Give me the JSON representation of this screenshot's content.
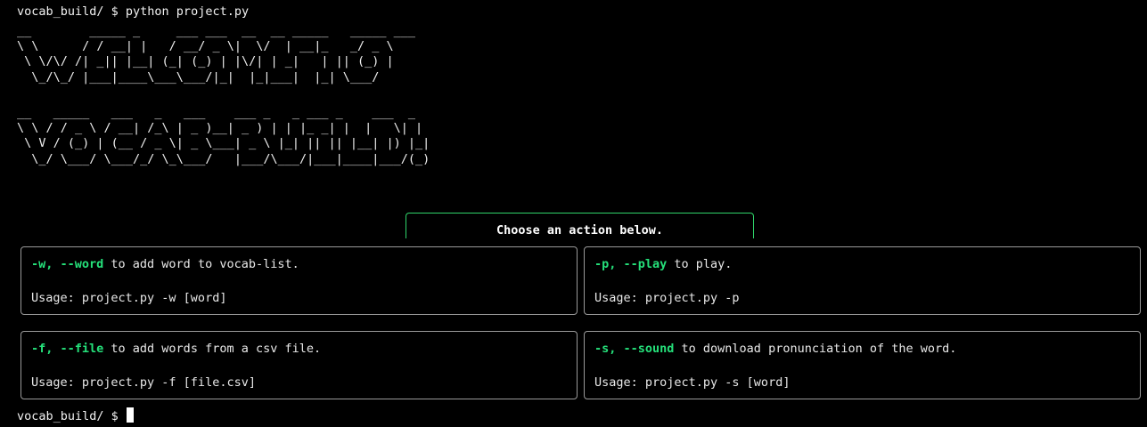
{
  "terminal": {
    "command_line": "vocab_build/ $ python project.py",
    "banner_top": "__        _____ _     ___ ___  __  __ _____   _____ ___\n\\ \\      / / __| |   / __/ _ \\|  \\/  | __|_   _/ _ \\\n \\ \\/\\/ /| _|| |__| (_| (_) | |\\/| | _|   | || (_) |\n  \\_/\\_/ |___|____\\___\\___/|_|  |_|___|  |_| \\___/",
    "banner_bottom": "__   _____   ___   _   ___    ___ _   _ ___ _    ___  _\n\\ \\ / / _ \\ / __| /_\\ | _ )__| _ ) | | |_ _| |  |   \\| |\n \\ V / (_) | (__ / _ \\| _ \\___| _ \\ |_| || || |__| |) |_|\n  \\_/ \\___/ \\___/_/ \\_\\___/   |___/\\___/|___|____|___/(_)",
    "panel_title": "Choose an action below.",
    "final_prompt": "vocab_build/ $ "
  },
  "actions": [
    {
      "flags": "-w, --word",
      "description": " to add word to vocab-list.",
      "usage": "Usage: project.py -w [word]"
    },
    {
      "flags": "-p, --play",
      "description": " to play.",
      "usage": "Usage: project.py -p"
    },
    {
      "flags": "-f, --file",
      "description": " to add words from a csv file.",
      "usage": "Usage: project.py -f [file.csv]"
    },
    {
      "flags": "-s, --sound",
      "description": " to download pronunciation of the word.",
      "usage": "Usage: project.py -s [word]"
    }
  ],
  "colors": {
    "background": "#000000",
    "flag_green": "#25e07a",
    "title_border": "#2fd46a",
    "card_border": "#9a9a9a"
  }
}
